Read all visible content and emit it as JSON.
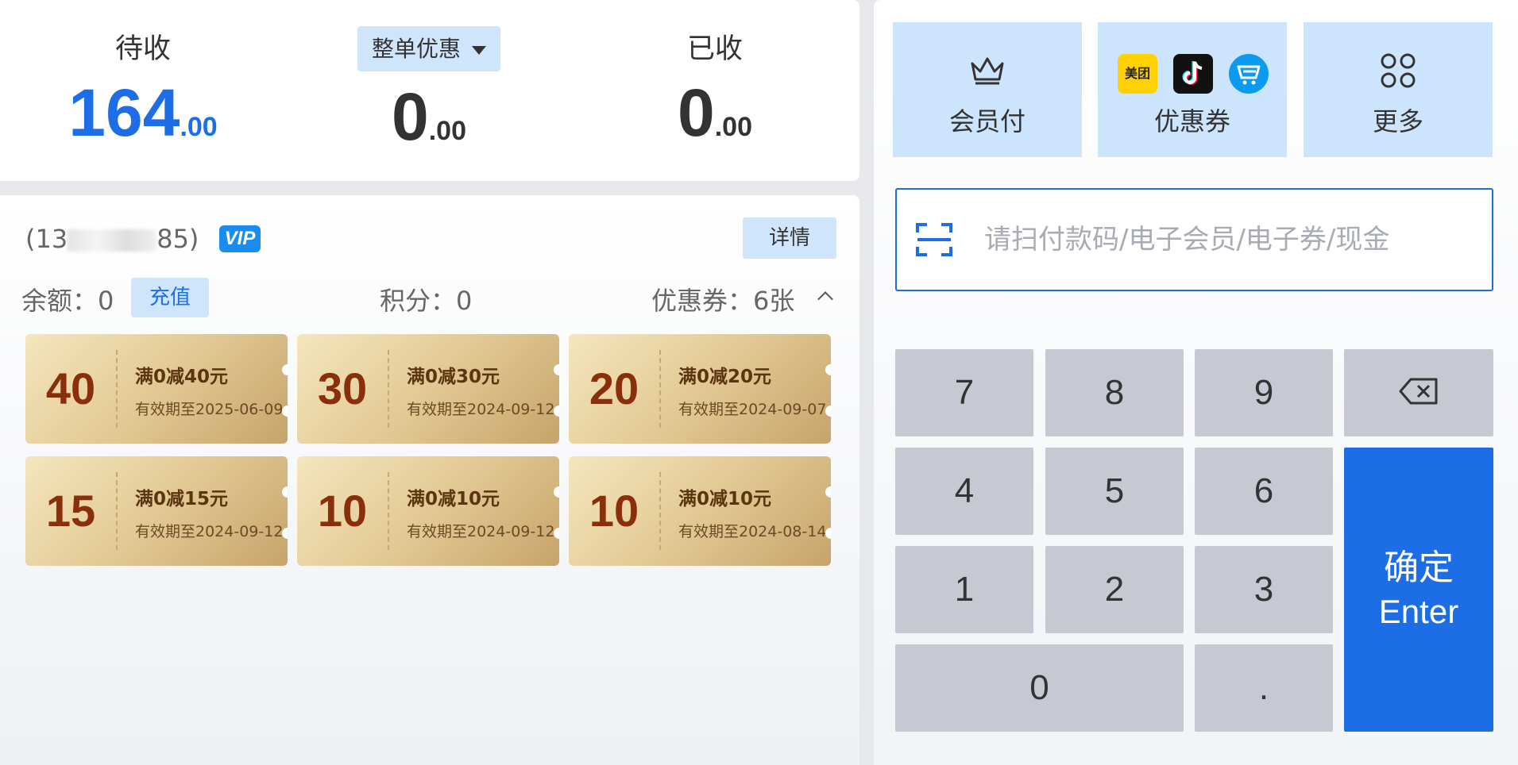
{
  "summary": {
    "pending": {
      "label": "待收",
      "int": "164",
      "dec": ".00"
    },
    "discount": {
      "label": "整单优惠",
      "int": "0",
      "dec": ".00"
    },
    "received": {
      "label": "已收",
      "int": "0",
      "dec": ".00"
    }
  },
  "member": {
    "phone_prefix": "(13",
    "phone_suffix": "85)",
    "vip_badge": "VIP",
    "detail_label": "详情",
    "balance": "余额：0",
    "recharge_label": "充值",
    "points": "积分：0",
    "coupons_count": "优惠券：6张"
  },
  "coupons": [
    {
      "amount": "40",
      "title": "满0减40元",
      "valid": "有效期至2025-06-09"
    },
    {
      "amount": "30",
      "title": "满0减30元",
      "valid": "有效期至2024-09-12"
    },
    {
      "amount": "20",
      "title": "满0减20元",
      "valid": "有效期至2024-09-07"
    },
    {
      "amount": "15",
      "title": "满0减15元",
      "valid": "有效期至2024-09-12"
    },
    {
      "amount": "10",
      "title": "满0减10元",
      "valid": "有效期至2024-09-12"
    },
    {
      "amount": "10",
      "title": "满0减10元",
      "valid": "有效期至2024-08-14"
    }
  ],
  "pay_methods": {
    "member_pay": "会员付",
    "coupon": "优惠券",
    "meituan_logo": "美团",
    "more": "更多"
  },
  "scan": {
    "placeholder": "请扫付款码/电子会员/电子券/现金"
  },
  "keypad": {
    "k7": "7",
    "k8": "8",
    "k9": "9",
    "k4": "4",
    "k5": "5",
    "k6": "6",
    "k1": "1",
    "k2": "2",
    "k3": "3",
    "k0": "0",
    "kdot": ".",
    "enter_cn": "确定",
    "enter_en": "Enter"
  },
  "colors": {
    "accent": "#1d6ee6",
    "button_light": "#cfe5fc",
    "key_gray": "#c6c8d2",
    "coupon_amount": "#8a2f0c"
  }
}
